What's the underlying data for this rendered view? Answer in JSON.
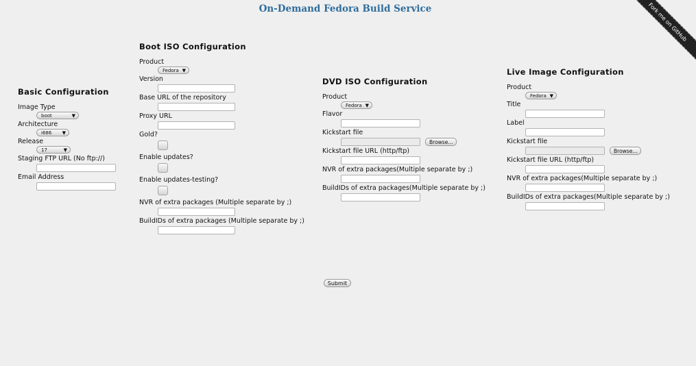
{
  "header": {
    "title": "On-Demand Fedora Build Service"
  },
  "ribbon": {
    "text": "Fork me on GitHub"
  },
  "basic": {
    "heading": "Basic Configuration",
    "image_type_label": "Image Type",
    "image_type_value": "boot",
    "architecture_label": "Architecture",
    "architecture_value": "i686",
    "release_label": "Release",
    "release_value": "17",
    "staging_label": "Staging FTP URL (No ftp://)",
    "email_label": "Email Address"
  },
  "boot": {
    "heading": "Boot ISO Configuration",
    "product_label": "Product",
    "product_value": "Fedora",
    "version_label": "Version",
    "base_url_label": "Base URL of the repository",
    "proxy_label": "Proxy URL",
    "gold_label": "Gold?",
    "updates_label": "Enable updates?",
    "updates_testing_label": "Enable updates-testing?",
    "nvr_label": "NVR of extra packages (Multiple separate by ;)",
    "buildids_label": "BuildIDs of extra packages (Multiple separate by ;)"
  },
  "dvd": {
    "heading": "DVD ISO Configuration",
    "product_label": "Product",
    "product_value": "Fedora",
    "flavor_label": "Flavor",
    "kickstart_label": "Kickstart file",
    "browse_label": "Browse...",
    "kickstart_url_label": "Kickstart file URL (http/ftp)",
    "nvr_label": "NVR of extra packages(Multiple separate by ;)",
    "buildids_label": "BuildIDs of extra packages(Multiple separate by ;)"
  },
  "live": {
    "heading": "Live Image Configuration",
    "product_label": "Product",
    "product_value": "Fedora",
    "title_label": "Title",
    "label_label": "Label",
    "kickstart_label": "Kickstart file",
    "browse_label": "Browse...",
    "kickstart_url_label": "Kickstart file URL (http/ftp)",
    "nvr_label": "NVR of extra packages(Multiple separate by ;)",
    "buildids_label": "BuildIDs of extra packages(Multiple separate by ;)"
  },
  "submit_label": "Submit"
}
